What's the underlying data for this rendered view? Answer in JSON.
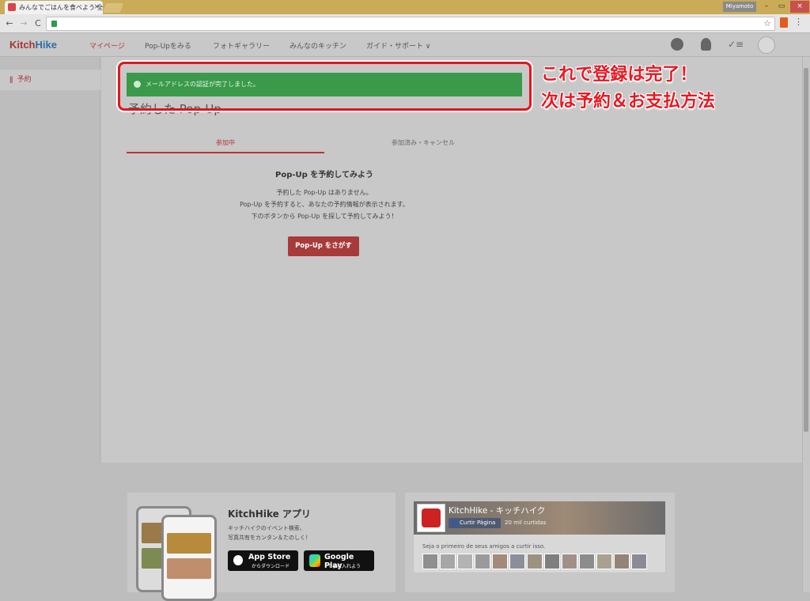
{
  "browser": {
    "tab_title": "みんなでごはんを食べよう 全",
    "tab_close": "×",
    "profile_name": "Miyamoto",
    "window_controls": [
      "–",
      "▭",
      "×"
    ],
    "nav": {
      "back": "←",
      "forward": "→",
      "reload": "C"
    },
    "star": "☆",
    "menu": "⋮"
  },
  "site": {
    "logo_kitch": "Kitch",
    "logo_hike": "Hike",
    "nav_items": [
      "マイページ",
      "Pop-Upをみる",
      "フォトギャラリー",
      "みんなのキッチン",
      "ガイド・サポート ∨"
    ],
    "tasks_icon_glyph": "✓≡"
  },
  "sidebar": {
    "icon_glyph": "ǁ",
    "item_label": "予約"
  },
  "alert": {
    "text": "メールアドレスの認証が完了しました。"
  },
  "main": {
    "page_title": "予約した Pop-Up",
    "tabs": [
      "参加中",
      "参加済み・キャンセル"
    ],
    "empty_heading": "Pop-Up を予約してみよう",
    "empty_lines": [
      "予約した Pop-Up はありません。",
      "Pop-Up を予約すると、あなたの予約情報が表示されます。",
      "下のボタンから Pop-Up を探して予約してみよう！"
    ],
    "cta_label": "Pop-Up をさがす"
  },
  "annotation": {
    "line1": "これで登録は完了！",
    "line2": "次は予約＆お支払方法",
    "color": "#e81822"
  },
  "footer": {
    "app": {
      "title": "KitchHike アプリ",
      "desc_lines": [
        "キッチハイクのイベント検索、",
        "写真共有をカンタン＆たのしく！"
      ],
      "appstore_main": "App Store",
      "appstore_sub": "からダウンロード",
      "googleplay_main": "Google Play",
      "googleplay_sub": "で手に入れよう"
    },
    "facebook": {
      "page_name": "KitchHike - キッチハイク",
      "like_label": "Curtir Página",
      "likes_count": "20 mil curtidas",
      "friends_text": "Seja o primeiro de seus amigos a curtir isso."
    }
  },
  "colors": {
    "accent_red": "#b33333",
    "alert_green": "#3a9a4a",
    "brand_blue": "#2e6fa8"
  }
}
